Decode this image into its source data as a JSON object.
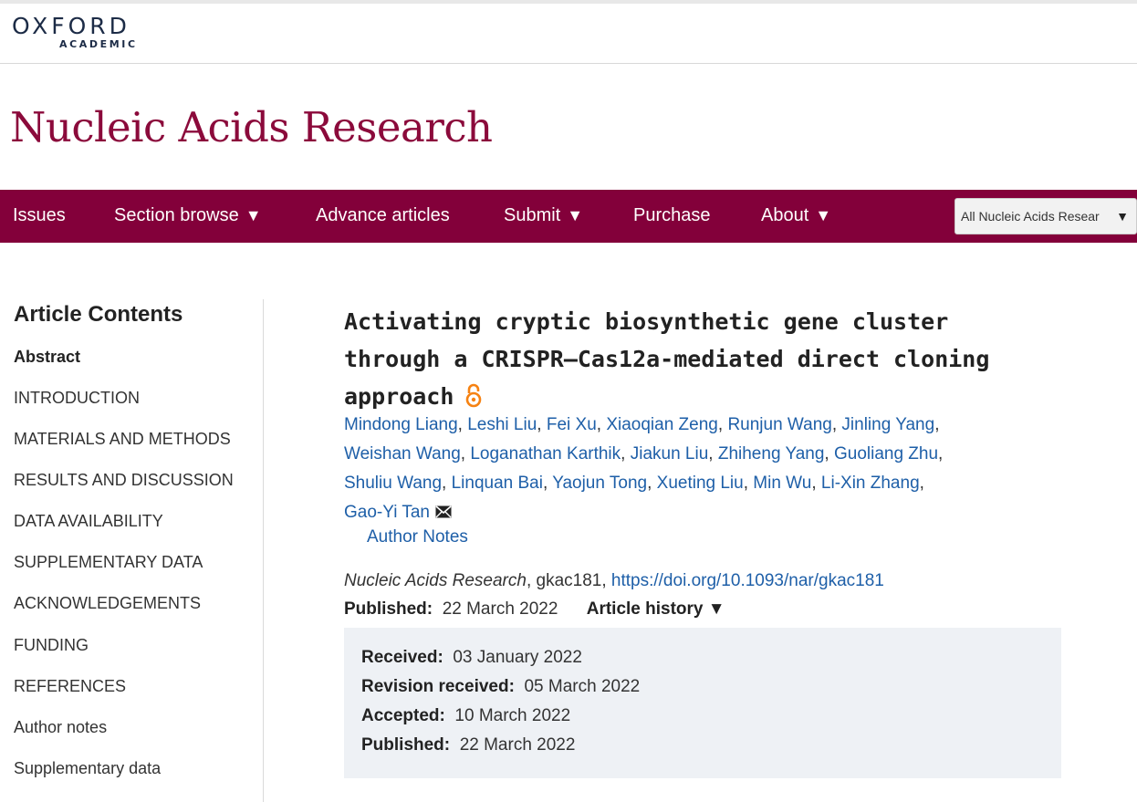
{
  "site": {
    "brand_word": "OXFORD",
    "brand_sub": "ACADEMIC",
    "brand_color": "#1c2b46"
  },
  "journal": {
    "title": "Nucleic Acids Research",
    "color": "#8b0a3b"
  },
  "nav": {
    "background": "#83003a",
    "items": [
      {
        "label": "Issues",
        "has_caret": false
      },
      {
        "label": "Section browse",
        "has_caret": true
      },
      {
        "label": "Advance articles",
        "has_caret": false
      },
      {
        "label": "Submit",
        "has_caret": true
      },
      {
        "label": "Purchase",
        "has_caret": false
      },
      {
        "label": "About",
        "has_caret": true
      }
    ],
    "caret": "▼",
    "search_scope": {
      "selected": "All Nucleic Acids Resear",
      "caret": "▼"
    }
  },
  "sidebar": {
    "title": "Article Contents",
    "items": [
      {
        "label": "Abstract",
        "active": true
      },
      {
        "label": "INTRODUCTION",
        "active": false
      },
      {
        "label": "MATERIALS AND METHODS",
        "active": false
      },
      {
        "label": "RESULTS AND DISCUSSION",
        "active": false
      },
      {
        "label": "DATA AVAILABILITY",
        "active": false
      },
      {
        "label": "SUPPLEMENTARY DATA",
        "active": false
      },
      {
        "label": "ACKNOWLEDGEMENTS",
        "active": false
      },
      {
        "label": "FUNDING",
        "active": false
      },
      {
        "label": "REFERENCES",
        "active": false
      },
      {
        "label": "Author notes",
        "active": false
      },
      {
        "label": "Supplementary data",
        "active": false
      }
    ]
  },
  "article": {
    "title_lines": [
      "Activating cryptic biosynthetic gene cluster",
      "through a CRISPR–Cas12a-mediated direct cloning",
      "approach"
    ],
    "open_access_icon": "open-access-icon",
    "author_lines": [
      [
        "Mindong Liang",
        "Leshi Liu",
        "Fei Xu",
        "Xiaoqian Zeng",
        "Runjun Wang",
        "Jinling Yang"
      ],
      [
        "Weishan Wang",
        "Loganathan Karthik",
        "Jiakun Liu",
        "Zhiheng Yang",
        "Guoliang Zhu"
      ],
      [
        "Shuliu Wang",
        "Linquan Bai",
        "Yaojun Tong",
        "Xueting Liu",
        "Min Wu",
        "Li-Xin Zhang"
      ],
      [
        "Gao-Yi Tan"
      ]
    ],
    "corresponding_icon": "envelope-icon",
    "author_notes_label": "Author Notes",
    "citation": {
      "journal": "Nucleic Acids Research",
      "separator": ", ",
      "article_id": "gkac181",
      "doi": "https://doi.org/10.1093/nar/gkac181"
    },
    "published_label": "Published:",
    "published_date": "22 March 2022",
    "history_toggle_label": "Article history",
    "history_toggle_caret": "▼",
    "history": [
      {
        "label": "Received:",
        "date": "03 January 2022"
      },
      {
        "label": "Revision received:",
        "date": "05 March 2022"
      },
      {
        "label": "Accepted:",
        "date": "10 March 2022"
      },
      {
        "label": "Published:",
        "date": "22 March 2022"
      }
    ],
    "link_color": "#1e5fa8",
    "history_panel_color": "#eef1f5"
  }
}
